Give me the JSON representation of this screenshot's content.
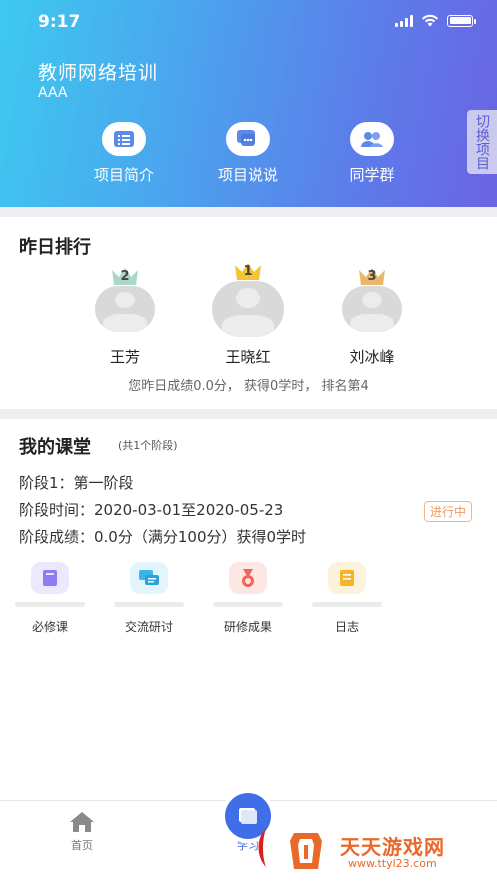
{
  "status_bar": {
    "time": "9:17"
  },
  "header": {
    "title": "教师网络培训",
    "subtitle": "AAA",
    "actions": [
      {
        "label": "项目简介",
        "icon": "list-icon"
      },
      {
        "label": "项目说说",
        "icon": "chat-icon"
      },
      {
        "label": "同学群",
        "icon": "group-icon"
      }
    ],
    "switch_label": "切换项目"
  },
  "ranking": {
    "title": "昨日排行",
    "entries": [
      {
        "rank": "2",
        "name": "王芳",
        "crown_color": "#a9d7c9"
      },
      {
        "rank": "1",
        "name": "王晓红",
        "crown_color": "#f5c433"
      },
      {
        "rank": "3",
        "name": "刘冰峰",
        "crown_color": "#e8b86a"
      }
    ],
    "summary": "您昨日成绩0.0分， 获得0学时， 排名第4"
  },
  "my_class": {
    "title": "我的课堂",
    "subtitle": "(共1个阶段)",
    "stage": "阶段1：第一阶段",
    "stage_time": "阶段时间：2020-03-01至2020-05-23",
    "stage_score": "阶段成绩：0.0分（满分100分）获得0学时",
    "status": "进行中",
    "modules": [
      {
        "label": "必修课",
        "icon": "book-icon",
        "color": "#8e7cf0",
        "bg": "#ece8fd"
      },
      {
        "label": "交流研讨",
        "icon": "discussion-icon",
        "color": "#3ab6ea",
        "bg": "#e3f5fc"
      },
      {
        "label": "研修成果",
        "icon": "medal-icon",
        "color": "#f0645a",
        "bg": "#fde7e5"
      },
      {
        "label": "日志",
        "icon": "note-icon",
        "color": "#f5b524",
        "bg": "#fdf3dc"
      }
    ]
  },
  "bottom_nav": {
    "home_label": "首页",
    "study_label": "学习"
  },
  "watermark": {
    "title": "天天游戏网",
    "url": "www.ttyl23.com"
  }
}
